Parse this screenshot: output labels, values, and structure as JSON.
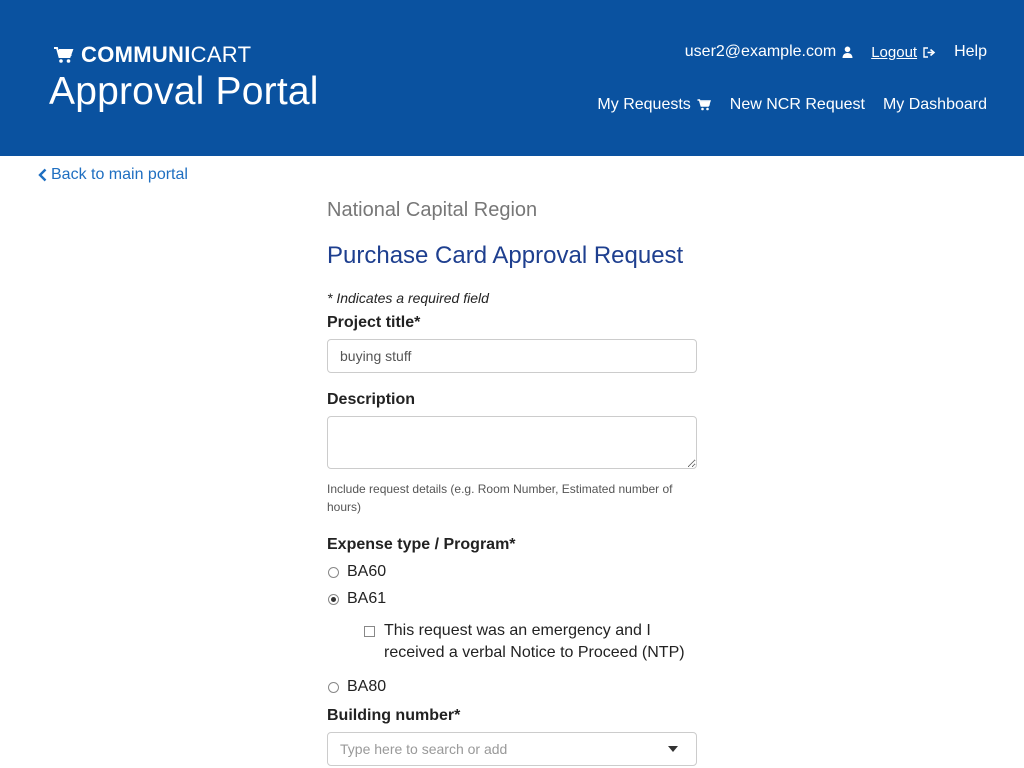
{
  "header": {
    "brand_bold": "COMMUNI",
    "brand_light": "CART",
    "title": "Approval Portal",
    "user_email": "user2@example.com",
    "logout_label": "Logout",
    "help_label": "Help",
    "nav": {
      "my_requests": "My Requests",
      "new_request": "New NCR Request",
      "dashboard": "My Dashboard"
    },
    "colors": {
      "background": "#0a52a0"
    }
  },
  "back_link": "Back to main portal",
  "form": {
    "region": "National Capital Region",
    "title": "Purchase Card Approval Request",
    "required_note": "* Indicates a required field",
    "project_title": {
      "label": "Project title*",
      "value": "buying stuff"
    },
    "description": {
      "label": "Description",
      "value": "",
      "help": "Include request details (e.g. Room Number, Estimated number of hours)"
    },
    "expense": {
      "label": "Expense type / Program*",
      "options": [
        "BA60",
        "BA61",
        "BA80"
      ],
      "selected": "BA61",
      "emergency_label": "This request was an emergency and I received a verbal Notice to Proceed (NTP)",
      "emergency_checked": false
    },
    "building": {
      "label": "Building number*",
      "placeholder": "Type here to search or add"
    }
  },
  "icons": [
    "cart-icon",
    "user-icon",
    "logout-icon",
    "chevron-left-icon",
    "caret-down-icon"
  ]
}
